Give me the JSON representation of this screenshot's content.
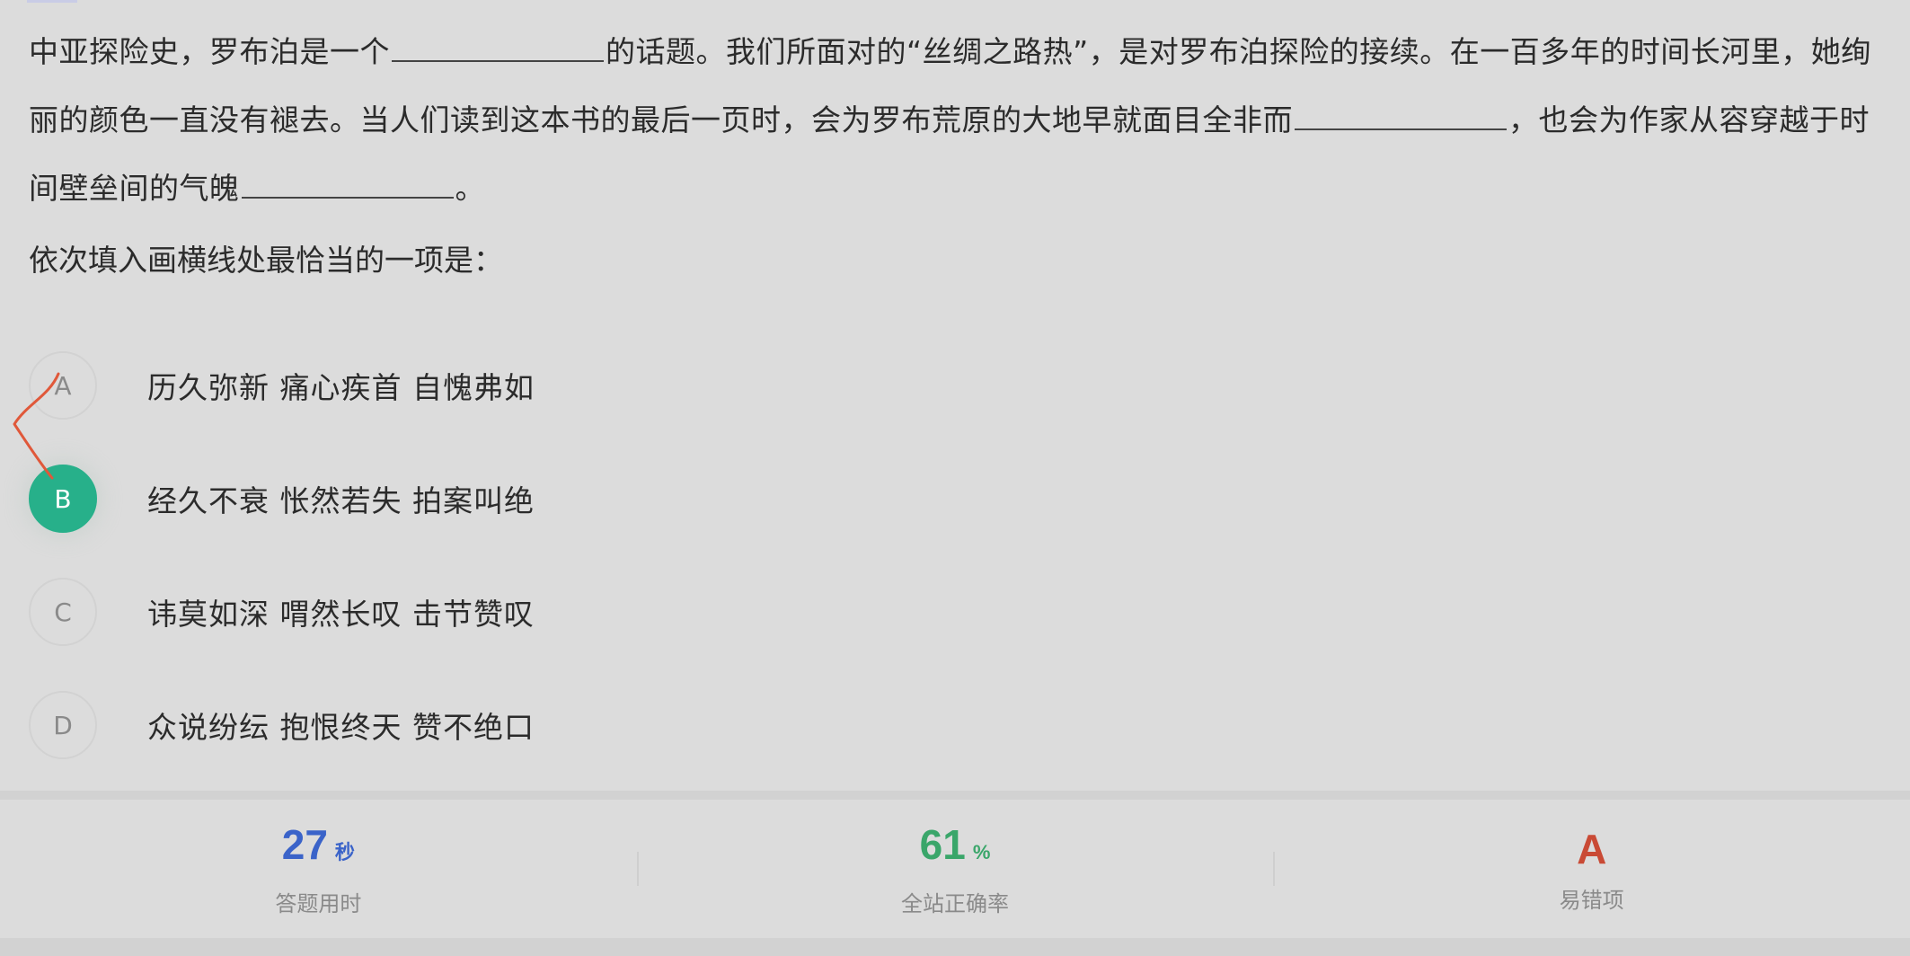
{
  "question": {
    "seg1": "中亚探险史，罗布泊是一个",
    "seg2": "的话题。我们所面对的“丝绸之路热”，是对罗布泊探险的接续。在一百多年的时间长河里，她绚丽的颜色一直没有褪去。当人们读到这本书的最后一页时，会为罗布荒原的大地早就面目全非而",
    "seg3": "，也会为作家从容穿越于时间壁垒间的气魄",
    "seg4": "。",
    "prompt": "依次填入画横线处最恰当的一项是："
  },
  "options": [
    {
      "letter": "A",
      "text": "历久弥新 痛心疾首 自愧弗如",
      "selected": false
    },
    {
      "letter": "B",
      "text": "经久不衰 怅然若失 拍案叫绝",
      "selected": true
    },
    {
      "letter": "C",
      "text": "讳莫如深 喟然长叹 击节赞叹",
      "selected": false
    },
    {
      "letter": "D",
      "text": "众说纷纭 抱恨终天 赞不绝口",
      "selected": false
    }
  ],
  "stats": {
    "time": {
      "value": "27",
      "unit": "秒",
      "label": "答题用时"
    },
    "accuracy": {
      "value": "61",
      "unit": "%",
      "label": "全站正确率"
    },
    "common_wrong": {
      "value": "A",
      "label": "易错项"
    }
  },
  "colors": {
    "selected": "#27b08a",
    "time": "#3a63c9",
    "accuracy": "#3aa66a",
    "wrong": "#c94a35",
    "pen_mark": "#e0583a"
  }
}
